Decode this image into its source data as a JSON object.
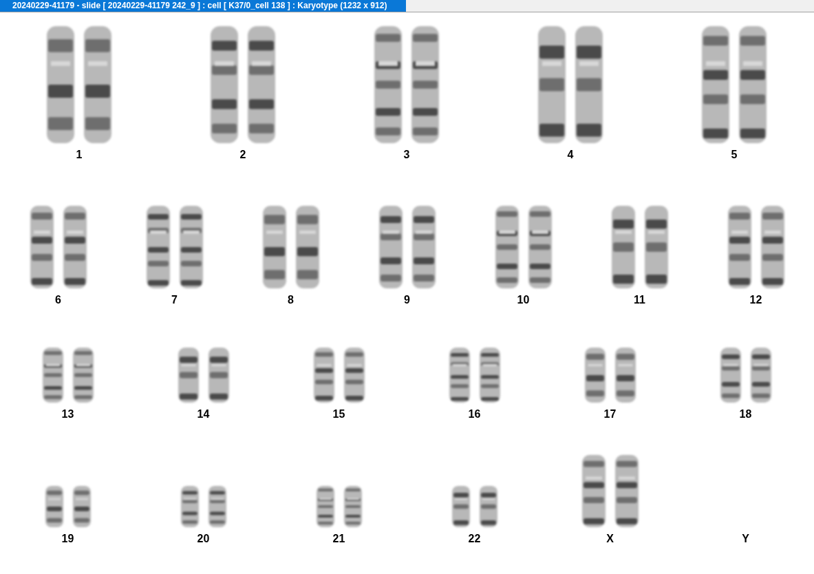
{
  "window": {
    "title": "20240229-41179 - slide [ 20240229-41179 242_9 ] : cell [ K37/0_cell 138 ] : Karyotype  (1232 x 912)"
  },
  "karyotype": {
    "rows": [
      {
        "pairs": [
          {
            "label": "1",
            "kind": "pair"
          },
          {
            "label": "2",
            "kind": "pair"
          },
          {
            "label": "3",
            "kind": "pair"
          },
          {
            "label": "4",
            "kind": "pair"
          },
          {
            "label": "5",
            "kind": "pair"
          }
        ]
      },
      {
        "pairs": [
          {
            "label": "6",
            "kind": "pair"
          },
          {
            "label": "7",
            "kind": "pair"
          },
          {
            "label": "8",
            "kind": "pair"
          },
          {
            "label": "9",
            "kind": "pair"
          },
          {
            "label": "10",
            "kind": "pair"
          },
          {
            "label": "11",
            "kind": "pair"
          },
          {
            "label": "12",
            "kind": "pair"
          }
        ]
      },
      {
        "pairs": [
          {
            "label": "13",
            "kind": "pair"
          },
          {
            "label": "14",
            "kind": "pair"
          },
          {
            "label": "15",
            "kind": "pair"
          },
          {
            "label": "16",
            "kind": "pair"
          },
          {
            "label": "17",
            "kind": "pair"
          },
          {
            "label": "18",
            "kind": "pair"
          }
        ]
      },
      {
        "pairs": [
          {
            "label": "19",
            "kind": "pair"
          },
          {
            "label": "20",
            "kind": "pair"
          },
          {
            "label": "21",
            "kind": "pair"
          },
          {
            "label": "22",
            "kind": "pair"
          },
          {
            "label": "X",
            "kind": "pair"
          },
          {
            "label": "Y",
            "kind": "empty"
          }
        ]
      }
    ]
  }
}
